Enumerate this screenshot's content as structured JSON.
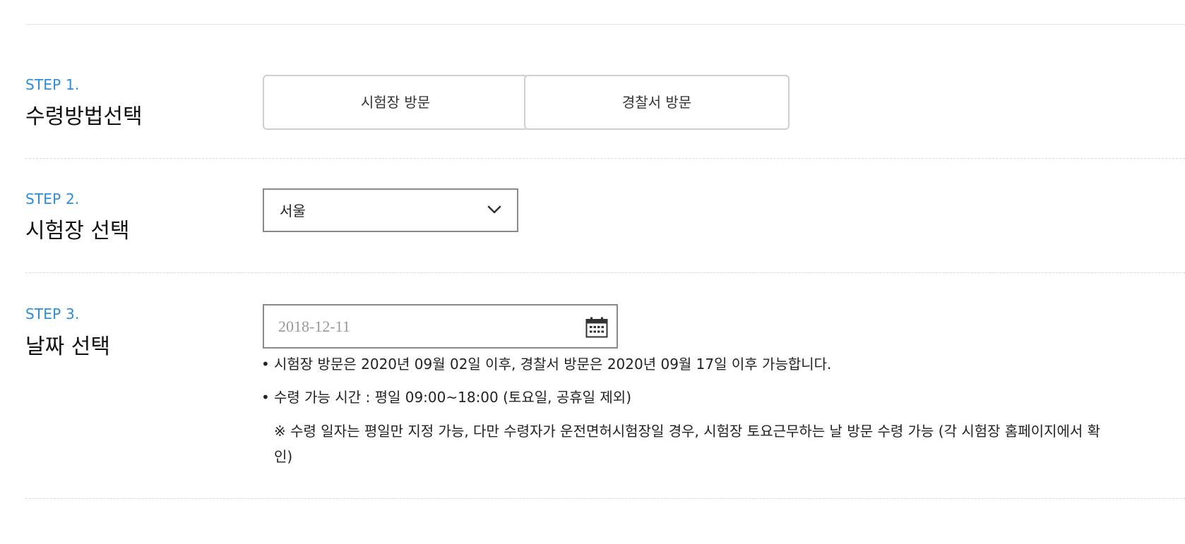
{
  "steps": [
    {
      "label": "STEP 1.",
      "title": "수령방법선택"
    },
    {
      "label": "STEP 2.",
      "title": "시험장 선택"
    },
    {
      "label": "STEP 3.",
      "title": "날짜 선택"
    }
  ],
  "receive_method": {
    "options": [
      "시험장 방문",
      "경찰서 방문"
    ]
  },
  "exam_center": {
    "selected": "서울"
  },
  "date": {
    "placeholder": "2018-12-11"
  },
  "notes": {
    "line1": "시험장 방문은 2020년 09월 02일 이후, 경찰서 방문은 2020년 09월 17일 이후 가능합니다.",
    "line2": "수령 가능 시간 : 평일 09:00~18:00 (토요일, 공휴일 제외)",
    "line3": "※ 수령 일자는 평일만 지정 가능, 다만 수령자가 운전면허시험장일 경우, 시험장 토요근무하는 날 방문 수령 가능 (각 시험장 홈페이지에서 확인)",
    "bullet": "•"
  },
  "icons": {
    "select_arrow": "chevron-down-icon",
    "date_picker": "calendar-icon"
  },
  "colors": {
    "step_label": "#2a8de0",
    "button_border": "#cfcfcf",
    "input_border": "#8a8a8a"
  }
}
